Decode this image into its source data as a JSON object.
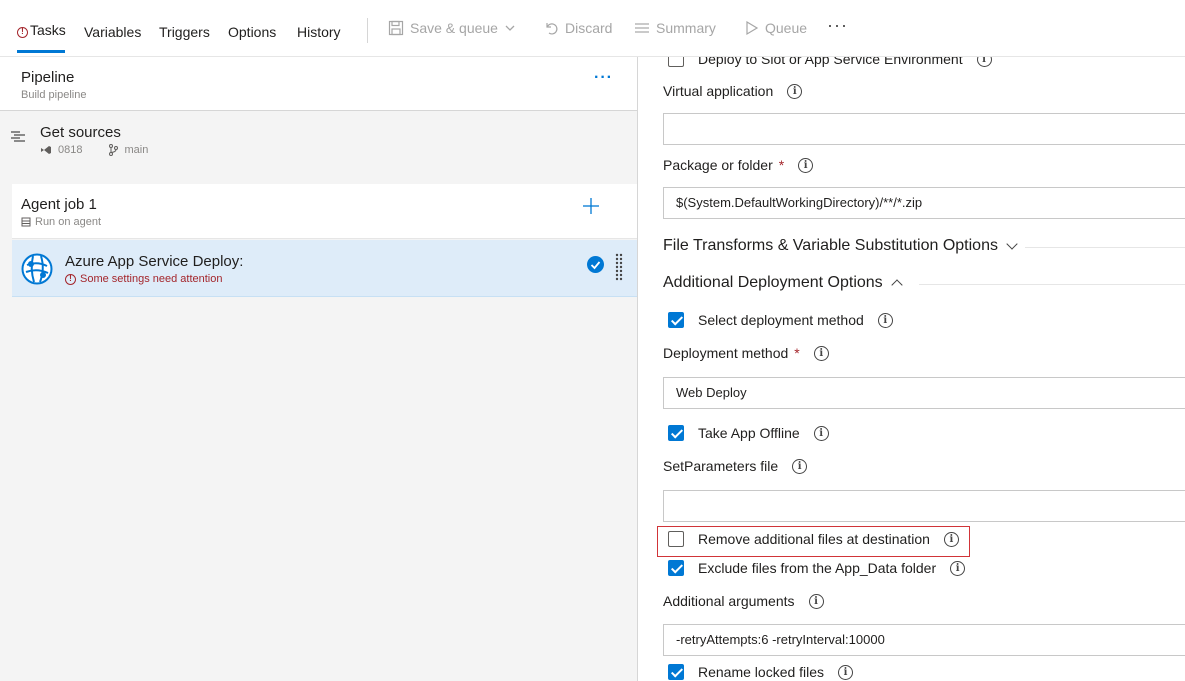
{
  "toolbar": {
    "tabs": [
      "Tasks",
      "Variables",
      "Triggers",
      "Options",
      "History"
    ],
    "save_queue": "Save & queue",
    "discard": "Discard",
    "summary": "Summary",
    "queue": "Queue",
    "more": "···"
  },
  "pipeline": {
    "title": "Pipeline",
    "subtitle": "Build pipeline",
    "more": "···"
  },
  "get_sources": {
    "title": "Get sources",
    "repo": "0818",
    "branch": "main"
  },
  "agent_job": {
    "title": "Agent job 1",
    "subtitle": "Run on agent"
  },
  "task": {
    "title": "Azure App Service Deploy:",
    "warning": "Some settings need attention"
  },
  "form": {
    "deploy_slot_label": "Deploy to Slot or App Service Environment",
    "virtual_app_label": "Virtual application",
    "virtual_app_value": "",
    "package_label": "Package or folder",
    "package_value": "$(System.DefaultWorkingDirectory)/**/*.zip",
    "file_transforms_label": "File Transforms & Variable Substitution Options",
    "additional_options_label": "Additional Deployment Options",
    "select_method_label": "Select deployment method",
    "method_label": "Deployment method",
    "method_value": "Web Deploy",
    "take_offline_label": "Take App Offline",
    "setparams_label": "SetParameters file",
    "setparams_value": "",
    "remove_files_label": "Remove additional files at destination",
    "exclude_appdata_label": "Exclude files from the App_Data folder",
    "additional_args_label": "Additional arguments",
    "additional_args_value": "-retryAttempts:6 -retryInterval:10000",
    "rename_locked_label": "Rename locked files",
    "required_mark": "*",
    "info_glyph": "i"
  },
  "colors": {
    "accent": "#0078d4",
    "error": "#a4262c",
    "highlight": "#d13438",
    "selected_bg": "#deecf9"
  }
}
